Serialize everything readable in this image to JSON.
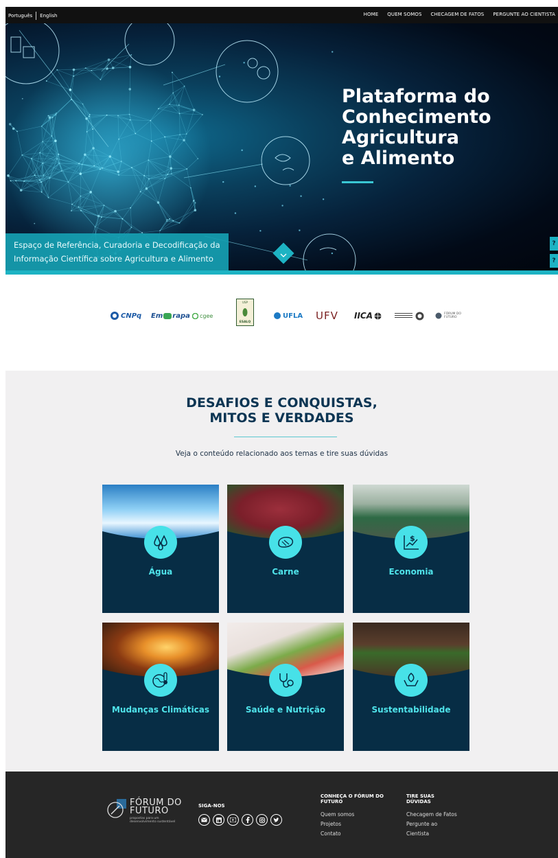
{
  "topbar": {
    "lang_pt": "Português",
    "lang_en": "English",
    "nav": [
      "HOME",
      "QUEM SOMOS",
      "CHECAGEM DE FATOS",
      "PERGUNTE AO CIENTISTA"
    ]
  },
  "hero": {
    "title_lines": [
      "Plataforma do",
      "Conhecimento",
      "Agricultura",
      "e Alimento"
    ],
    "caption_lines": [
      "Espaço de Referência, Curadoria e Decodificação da",
      "Informação Científica sobre Agricultura e Alimento"
    ],
    "side_buttons": [
      "?",
      "?"
    ]
  },
  "partners": {
    "cnpq": "CNPq",
    "embrapa_a": "Em",
    "embrapa_b": "rapa",
    "cgee": "cgee",
    "esalq_top": "USP",
    "esalq": "ESALQ",
    "ufla": "UFLA",
    "ufv": "UFV",
    "iica": "IICA",
    "forum": "FÓRUM DO FUTURO"
  },
  "section": {
    "title_line1": "DESAFIOS E CONQUISTAS,",
    "title_line2": "MITOS E VERDADES",
    "subtitle": "Veja o conteúdo relacionado aos temas e tire suas dúvidas",
    "cards": [
      {
        "label": "Água",
        "icon": "water-drops-icon"
      },
      {
        "label": "Carne",
        "icon": "steak-icon"
      },
      {
        "label": "Economia",
        "icon": "finance-chart-icon"
      },
      {
        "label": "Mudanças Climáticas",
        "icon": "globe-thermometer-icon"
      },
      {
        "label": "Saúde e Nutrição",
        "icon": "stethoscope-apple-icon"
      },
      {
        "label": "Sustentabilidade",
        "icon": "hands-leaf-icon"
      }
    ]
  },
  "footer": {
    "brand_line1": "FÓRUM DO",
    "brand_line2": "FUTURO",
    "brand_sub": "propostas para um desenvolvimento sustentável",
    "follow_heading": "SIGA-NOS",
    "social": [
      "email-icon",
      "linkedin-icon",
      "youtube-icon",
      "facebook-icon",
      "instagram-icon",
      "twitter-icon"
    ],
    "col1_heading_line1": "CONHEÇA O FÓRUM DO",
    "col1_heading_line2": "FUTURO",
    "col1_links": [
      "Quem somos",
      "Projetos",
      "Contato"
    ],
    "col2_heading_line1": "TIRE SUAS",
    "col2_heading_line2": "DÚVIDAS",
    "col2_links": [
      "Checagem de Fatos",
      "Pergunte ao",
      "Cientista"
    ]
  },
  "colors": {
    "accent": "#1db3c3",
    "card_bg": "#072d45",
    "card_label": "#4fe3ea",
    "section_bg": "#f1f0f1",
    "footer_bg": "#262626",
    "title": "#0c3553"
  }
}
